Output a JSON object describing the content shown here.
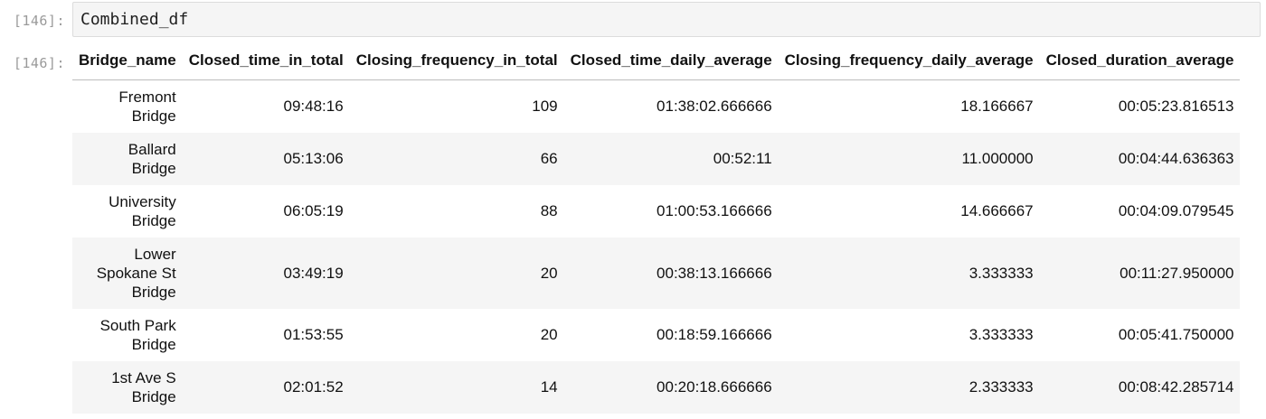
{
  "cells": {
    "input_prompt": "[146]:",
    "output_prompt": "[146]:",
    "code": "Combined_df"
  },
  "table": {
    "columns": [
      "Bridge_name",
      "Closed_time_in_total",
      "Closing_frequency_in_total",
      "Closed_time_daily_average",
      "Closing_frequency_daily_average",
      "Closed_duration_average"
    ],
    "rows": [
      {
        "name_lines": [
          "Fremont",
          "Bridge"
        ],
        "values": [
          "09:48:16",
          "109",
          "01:38:02.666666",
          "18.166667",
          "00:05:23.816513"
        ]
      },
      {
        "name_lines": [
          "Ballard",
          "Bridge"
        ],
        "values": [
          "05:13:06",
          "66",
          "00:52:11",
          "11.000000",
          "00:04:44.636363"
        ]
      },
      {
        "name_lines": [
          "University",
          "Bridge"
        ],
        "values": [
          "06:05:19",
          "88",
          "01:00:53.166666",
          "14.666667",
          "00:04:09.079545"
        ]
      },
      {
        "name_lines": [
          "Lower",
          "Spokane St",
          "Bridge"
        ],
        "values": [
          "03:49:19",
          "20",
          "00:38:13.166666",
          "3.333333",
          "00:11:27.950000"
        ]
      },
      {
        "name_lines": [
          "South Park",
          "Bridge"
        ],
        "values": [
          "01:53:55",
          "20",
          "00:18:59.166666",
          "3.333333",
          "00:05:41.750000"
        ]
      },
      {
        "name_lines": [
          "1st Ave S",
          "Bridge"
        ],
        "values": [
          "02:01:52",
          "14",
          "00:20:18.666666",
          "2.333333",
          "00:08:42.285714"
        ]
      }
    ]
  }
}
